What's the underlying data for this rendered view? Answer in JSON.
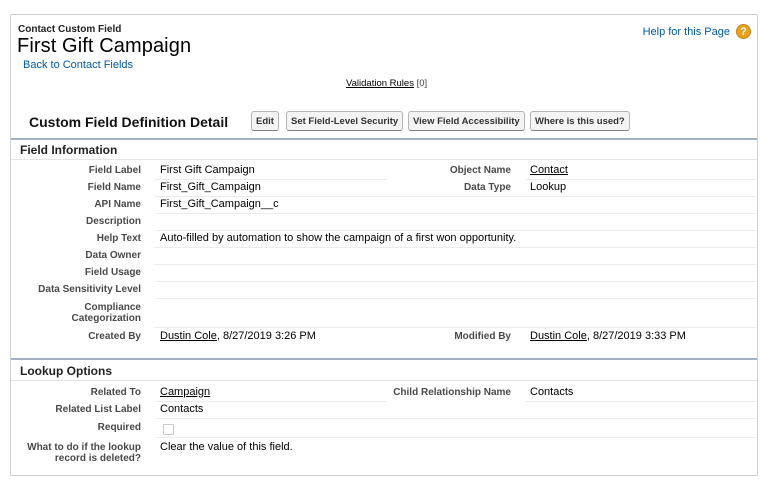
{
  "header": {
    "eyebrow": "Contact Custom Field",
    "title": "First Gift Campaign",
    "back_link": "Back to Contact Fields",
    "help_link": "Help for this Page",
    "help_icon": "question-icon"
  },
  "validation": {
    "label": "Validation Rules",
    "count": "[0]"
  },
  "detail": {
    "title": "Custom Field Definition Detail",
    "buttons": {
      "edit": "Edit",
      "security": "Set Field-Level Security",
      "accessibility": "View Field Accessibility",
      "where_used": "Where is this used?"
    }
  },
  "field_info": {
    "heading": "Field Information",
    "field_label": {
      "label": "Field Label",
      "value": "First Gift Campaign"
    },
    "object_name": {
      "label": "Object Name",
      "value": "Contact"
    },
    "field_name": {
      "label": "Field Name",
      "value": "First_Gift_Campaign"
    },
    "data_type": {
      "label": "Data Type",
      "value": "Lookup"
    },
    "api_name": {
      "label": "API Name",
      "value": "First_Gift_Campaign__c"
    },
    "description": {
      "label": "Description",
      "value": ""
    },
    "help_text": {
      "label": "Help Text",
      "value": "Auto-filled by automation to show the campaign of a first won opportunity."
    },
    "data_owner": {
      "label": "Data Owner",
      "value": ""
    },
    "field_usage": {
      "label": "Field Usage",
      "value": ""
    },
    "sensitivity": {
      "label": "Data Sensitivity Level",
      "value": ""
    },
    "compliance": {
      "label_1": "Compliance",
      "label_2": "Categorization",
      "value": ""
    },
    "created_by": {
      "label": "Created By",
      "user": "Dustin Cole",
      "date": ", 8/27/2019 3:26 PM"
    },
    "modified_by": {
      "label": "Modified By",
      "user": "Dustin Cole",
      "date": ", 8/27/2019 3:33 PM"
    }
  },
  "lookup": {
    "heading": "Lookup Options",
    "related_to": {
      "label": "Related To",
      "value": "Campaign"
    },
    "child_rel": {
      "label": "Child Relationship Name",
      "value": "Contacts"
    },
    "related_list": {
      "label": "Related List Label",
      "value": "Contacts"
    },
    "required": {
      "label": "Required",
      "checked": false
    },
    "on_delete": {
      "label_1": "What to do if the lookup",
      "label_2": "record is deleted?",
      "value": "Clear the value of this field."
    }
  }
}
